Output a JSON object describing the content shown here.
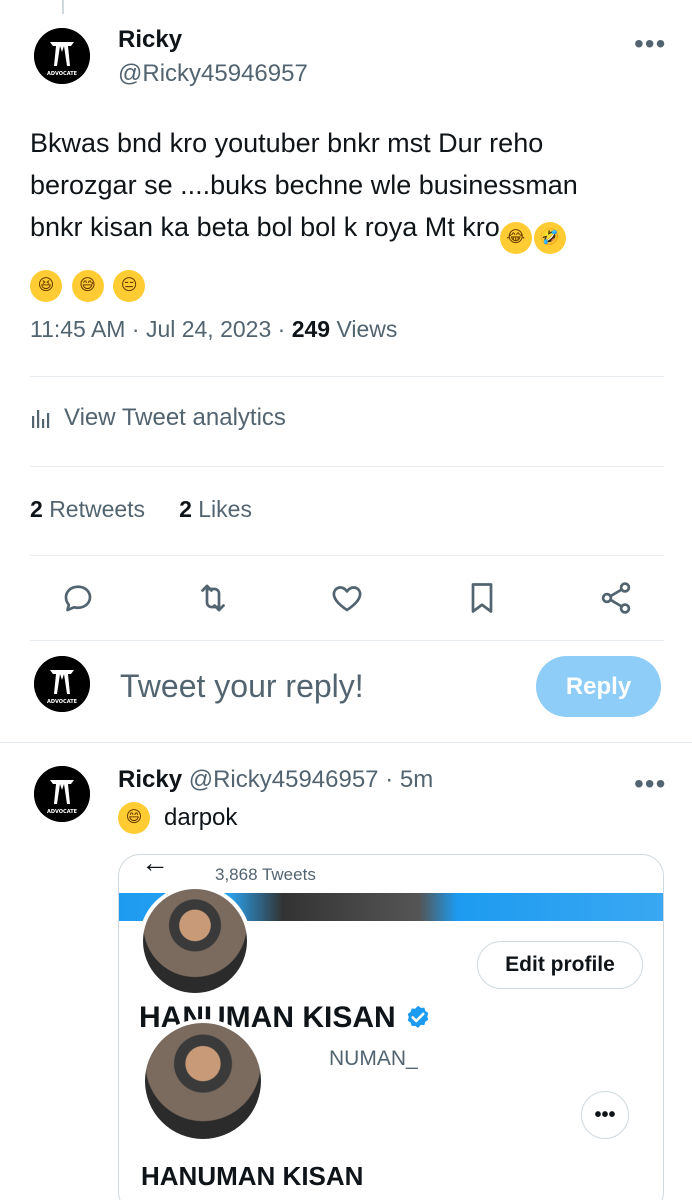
{
  "tweet": {
    "author_name": "Ricky",
    "author_handle": "@Ricky45946957",
    "more": "•••",
    "text_lines": [
      "Bkwas bnd kro youtuber bnkr mst Dur reho",
      "berozgar se ....buks bechne wle businessman",
      "bnkr kisan ka beta bol bol k roya Mt  kro"
    ],
    "emojis_inline": [
      "😂",
      "🤣"
    ],
    "emojis_line4": [
      "😆",
      "😅",
      "😑"
    ],
    "time": "11:45 AM",
    "date": "Jul 24, 2023",
    "views_count": "249",
    "views_label": "Views",
    "analytics_label": "View Tweet analytics",
    "retweets_count": "2",
    "retweets_label": "Retweets",
    "likes_count": "2",
    "likes_label": "Likes"
  },
  "reply_box": {
    "placeholder": "Tweet your reply!",
    "button_label": "Reply"
  },
  "reply": {
    "author_name": "Ricky",
    "author_handle": "@Ricky45946957",
    "time_ago": "5m",
    "emoji": "😄",
    "text": "darpok",
    "more": "•••"
  },
  "embedded_card": {
    "tweets_count": "3,868 Tweets",
    "edit_profile": "Edit profile",
    "profile_name_overlay": "HANUMAN KISAN",
    "profile_handle_partial": "NUMAN_",
    "more": "•••",
    "profile_name": "HANUMAN KISAN"
  },
  "avatar_text": "ADVOCATE",
  "colors": {
    "accent": "#1d9bf0",
    "reply_button_disabled": "#8ecdf7",
    "secondary_text": "#536471",
    "primary_text": "#0f1419",
    "divider": "#e7ecf0"
  }
}
